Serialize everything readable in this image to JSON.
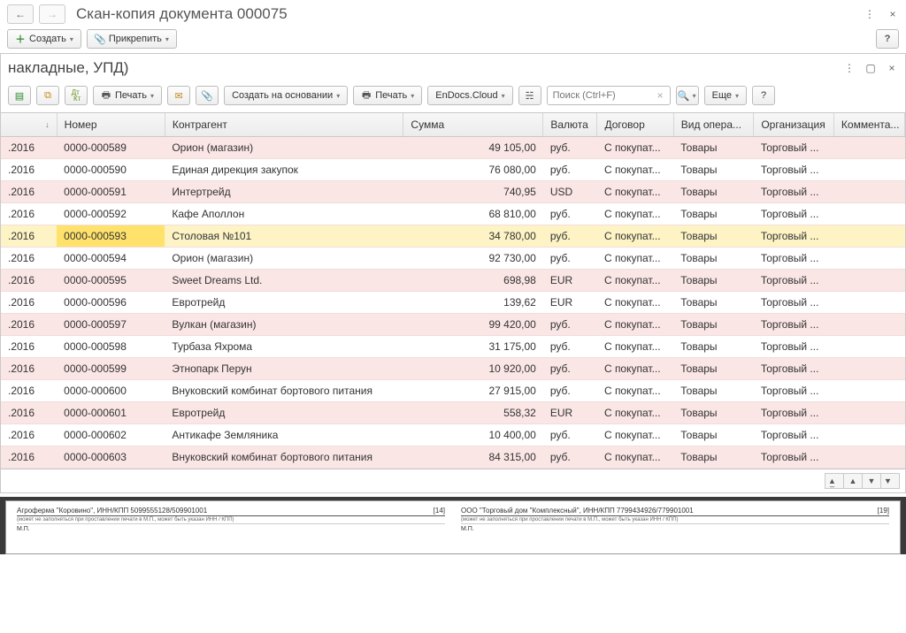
{
  "doc": {
    "title": "Скан-копия документа 000075",
    "create": "Создать",
    "attach": "Прикрепить"
  },
  "sheet": {
    "title": "накладные, УПД)",
    "print": "Печать",
    "create_based": "Создать на основании",
    "print2": "Печать",
    "endocs": "EnDocs.Cloud",
    "search_placeholder": "Поиск (Ctrl+F)",
    "more": "Еще"
  },
  "columns": {
    "date": "",
    "number": "Номер",
    "agent": "Контрагент",
    "sum": "Сумма",
    "currency": "Валюта",
    "contract": "Договор",
    "operation": "Вид опера...",
    "org": "Организация",
    "comment": "Коммента..."
  },
  "rows": [
    {
      "date": ".2016",
      "num": "0000-000589",
      "agent": "Орион (магазин)",
      "sum": "49 105,00",
      "cur": "руб.",
      "dog": "С покупат...",
      "op": "Товары",
      "org": "Торговый ...",
      "sel": false
    },
    {
      "date": ".2016",
      "num": "0000-000590",
      "agent": "Единая дирекция закупок",
      "sum": "76 080,00",
      "cur": "руб.",
      "dog": "С покупат...",
      "op": "Товары",
      "org": "Торговый ...",
      "sel": false
    },
    {
      "date": ".2016",
      "num": "0000-000591",
      "agent": "Интертрейд",
      "sum": "740,95",
      "cur": "USD",
      "dog": "С покупат...",
      "op": "Товары",
      "org": "Торговый ...",
      "sel": false
    },
    {
      "date": ".2016",
      "num": "0000-000592",
      "agent": "Кафе Аполлон",
      "sum": "68 810,00",
      "cur": "руб.",
      "dog": "С покупат...",
      "op": "Товары",
      "org": "Торговый ...",
      "sel": false
    },
    {
      "date": ".2016",
      "num": "0000-000593",
      "agent": "Столовая №101",
      "sum": "34 780,00",
      "cur": "руб.",
      "dog": "С покупат...",
      "op": "Товары",
      "org": "Торговый ...",
      "sel": true
    },
    {
      "date": ".2016",
      "num": "0000-000594",
      "agent": "Орион (магазин)",
      "sum": "92 730,00",
      "cur": "руб.",
      "dog": "С покупат...",
      "op": "Товары",
      "org": "Торговый ...",
      "sel": false
    },
    {
      "date": ".2016",
      "num": "0000-000595",
      "agent": "Sweet Dreams Ltd.",
      "sum": "698,98",
      "cur": "EUR",
      "dog": "С покупат...",
      "op": "Товары",
      "org": "Торговый ...",
      "sel": false
    },
    {
      "date": ".2016",
      "num": "0000-000596",
      "agent": "Евротрейд",
      "sum": "139,62",
      "cur": "EUR",
      "dog": "С покупат...",
      "op": "Товары",
      "org": "Торговый ...",
      "sel": false
    },
    {
      "date": ".2016",
      "num": "0000-000597",
      "agent": "Вулкан (магазин)",
      "sum": "99 420,00",
      "cur": "руб.",
      "dog": "С покупат...",
      "op": "Товары",
      "org": "Торговый ...",
      "sel": false
    },
    {
      "date": ".2016",
      "num": "0000-000598",
      "agent": "Турбаза Яхрома",
      "sum": "31 175,00",
      "cur": "руб.",
      "dog": "С покупат...",
      "op": "Товары",
      "org": "Торговый ...",
      "sel": false
    },
    {
      "date": ".2016",
      "num": "0000-000599",
      "agent": "Этнопарк Перун",
      "sum": "10 920,00",
      "cur": "руб.",
      "dog": "С покупат...",
      "op": "Товары",
      "org": "Торговый ...",
      "sel": false
    },
    {
      "date": ".2016",
      "num": "0000-000600",
      "agent": "Внуковский комбинат бортового питания",
      "sum": "27 915,00",
      "cur": "руб.",
      "dog": "С покупат...",
      "op": "Товары",
      "org": "Торговый ...",
      "sel": false
    },
    {
      "date": ".2016",
      "num": "0000-000601",
      "agent": "Евротрейд",
      "sum": "558,32",
      "cur": "EUR",
      "dog": "С покупат...",
      "op": "Товары",
      "org": "Торговый ...",
      "sel": false
    },
    {
      "date": ".2016",
      "num": "0000-000602",
      "agent": "Антикафе Земляника",
      "sum": "10 400,00",
      "cur": "руб.",
      "dog": "С покупат...",
      "op": "Товары",
      "org": "Торговый ...",
      "sel": false
    },
    {
      "date": ".2016",
      "num": "0000-000603",
      "agent": "Внуковский комбинат бортового питания",
      "sum": "84 315,00",
      "cur": "руб.",
      "dog": "С покупат...",
      "op": "Товары",
      "org": "Торговый ...",
      "sel": false
    }
  ],
  "scan": {
    "left_party": "Агроферма \"Коровино\", ИНН/КПП 5099555128/509901001",
    "right_party": "ООО \"Торговый дом \"Комплексный\", ИНН/КПП 7799434926/779901001",
    "left_num": "[14]",
    "right_num": "[19]",
    "hint": "(может не заполняться при проставлении печати в М.П., может быть указан ИНН / КПП)",
    "mp": "М.П."
  }
}
